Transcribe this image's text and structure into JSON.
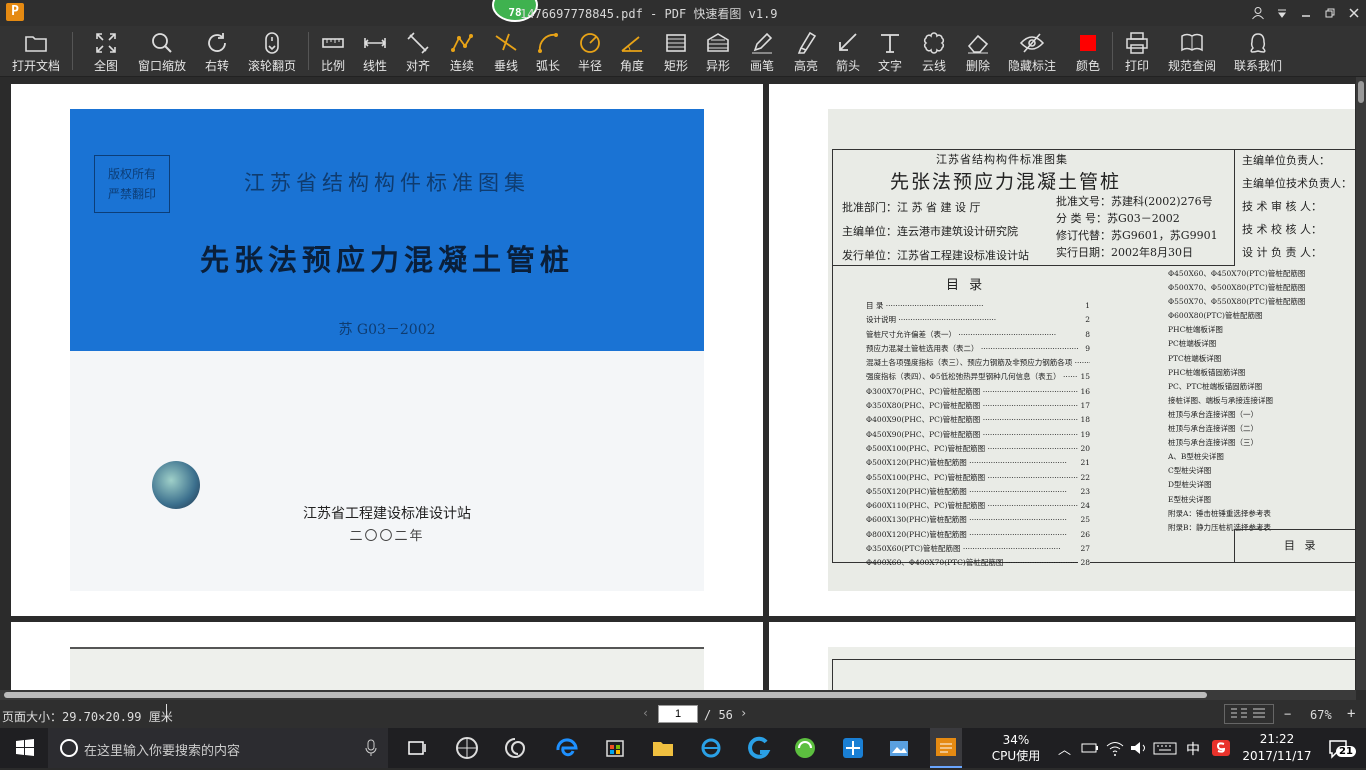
{
  "window": {
    "title": "1476697778845.pdf - PDF 快速看图 v1.9",
    "notification_count": "78",
    "logo_letter": "P"
  },
  "toolbar": {
    "open": "打开文档",
    "fit_all": "全图",
    "window_zoom": "窗口缩放",
    "rotate_right": "右转",
    "scroll_page": "滚轮翻页",
    "scale": "比例",
    "linear": "线性",
    "aligned": "对齐",
    "continuous": "连续",
    "perpendicular": "垂线",
    "arc_length": "弧长",
    "radius": "半径",
    "angle": "角度",
    "rectangle": "矩形",
    "irregular": "异形",
    "pen": "画笔",
    "highlighter": "高亮",
    "arrow": "箭头",
    "text": "文字",
    "cloud": "云线",
    "delete": "删除",
    "hide_markup": "隐藏标注",
    "color": "颜色",
    "print": "打印",
    "spec_query": "规范查阅",
    "contact": "联系我们"
  },
  "colors": {
    "accent_orange": "#e8a317",
    "markup_red": "#ff0000"
  },
  "cover": {
    "stamp_line1": "版权所有",
    "stamp_line2": "严禁翻印",
    "series": "江苏省结构构件标准图集",
    "title": "先张法预应力混凝土管桩",
    "code": "苏 G03－2002",
    "publisher": "江苏省工程建设标准设计站",
    "year": "二〇〇二年"
  },
  "catalog": {
    "series": "江苏省结构构件标准图集",
    "title": "先张法预应力混凝土管桩",
    "approval_dept": "批准部门：江 苏 省 建 设 厅",
    "editor_unit": "主编单位：连云港市建筑设计研究院",
    "issuer": "发行单位：江苏省工程建设标准设计站",
    "approval_no": "批准文号：苏建科(2002)276号",
    "category_no": "分 类 号：苏G03－2002",
    "replaces": "修订代替：苏G9601，苏G9901",
    "effective": "实行日期：2002年8月30日",
    "roles": [
      "主编单位负责人：",
      "主编单位技术负责人：",
      "技 术 审 核 人：",
      "技 术 校 核 人：",
      "设 计 负 责 人："
    ],
    "toc_heading": "目 录",
    "footer_label": "目 录",
    "left_items": [
      {
        "t": "目 录",
        "p": "1"
      },
      {
        "t": "设计说明",
        "p": "2"
      },
      {
        "t": "管桩尺寸允许偏差（表一）",
        "p": "8"
      },
      {
        "t": "预应力混凝土管桩选用表（表二）",
        "p": "9"
      },
      {
        "t": "混凝土各项强度指标（表三）、预应力钢筋及非预应力钢筋各项",
        "p": ""
      },
      {
        "t": "强度指标（表四）、Φ5低松弛热异型钢种几何信息（表五）",
        "p": "15"
      },
      {
        "t": "Φ300X70(PHC、PC)管桩配筋图",
        "p": "16"
      },
      {
        "t": "Φ350X80(PHC、PC)管桩配筋图",
        "p": "17"
      },
      {
        "t": "Φ400X90(PHC、PC)管桩配筋图",
        "p": "18"
      },
      {
        "t": "Φ450X90(PHC、PC)管桩配筋图",
        "p": "19"
      },
      {
        "t": "Φ500X100(PHC、PC)管桩配筋图",
        "p": "20"
      },
      {
        "t": "Φ500X120(PHC)管桩配筋图",
        "p": "21"
      },
      {
        "t": "Φ550X100(PHC、PC)管桩配筋图",
        "p": "22"
      },
      {
        "t": "Φ550X120(PHC)管桩配筋图",
        "p": "23"
      },
      {
        "t": "Φ600X110(PHC、PC)管桩配筋图",
        "p": "24"
      },
      {
        "t": "Φ600X130(PHC)管桩配筋图",
        "p": "25"
      },
      {
        "t": "Φ800X120(PHC)管桩配筋图",
        "p": "26"
      },
      {
        "t": "Φ350X60(PTC)管桩配筋图",
        "p": "27"
      },
      {
        "t": "Φ400X60、Φ400X70(PTC)管桩配筋图",
        "p": "28"
      }
    ],
    "right_items": [
      "Φ450X60、Φ450X70(PTC)管桩配筋图",
      "Φ500X70、Φ500X80(PTC)管桩配筋图",
      "Φ550X70、Φ550X80(PTC)管桩配筋图",
      "Φ600X80(PTC)管桩配筋图",
      "PHC桩端板详图",
      "PC桩端板详图",
      "PTC桩端板详图",
      "PHC桩端板锚固筋详图",
      "PC、PTC桩端板锚固筋详图",
      "接桩详图、端板与承接连接详图",
      "桩顶与承台连接详图（一）",
      "桩顶与承台连接详图（二）",
      "桩顶与承台连接详图（三）",
      "A、B型桩尖详图",
      "C型桩尖详图",
      "D型桩尖详图",
      "E型桩尖详图",
      "附录A：锤击桩锤重选择参考表",
      "附录B：静力压桩机选择参考表"
    ]
  },
  "status": {
    "page_size": "页面大小：29.70×20.99 厘米",
    "current_page": "1",
    "total_pages": "/  56",
    "zoom": "67%",
    "zoom_minus": "−",
    "zoom_plus": "+"
  },
  "taskbar": {
    "search_placeholder": "在这里输入你要搜索的内容",
    "cpu_percent": "34%",
    "cpu_label": "CPU使用",
    "ime": "中",
    "time": "21:22",
    "date": "2017/11/17",
    "notif_count": "21"
  }
}
